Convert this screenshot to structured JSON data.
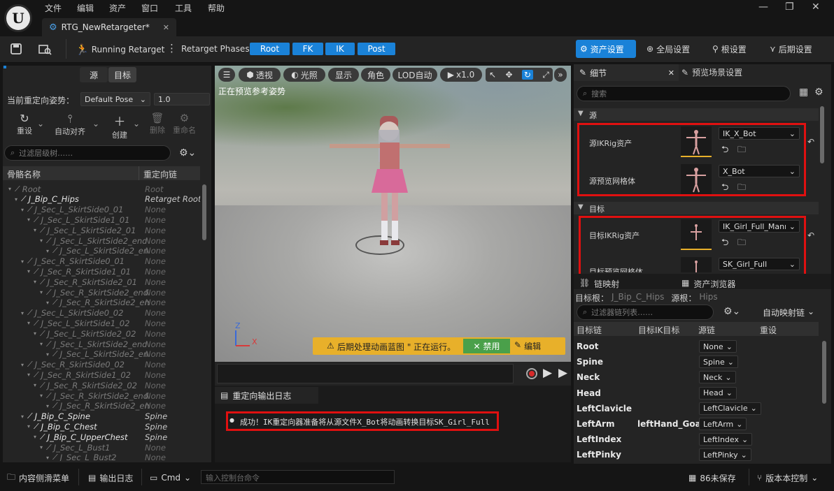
{
  "menu": [
    "文件",
    "编辑",
    "资产",
    "窗口",
    "工具",
    "帮助"
  ],
  "window_controls": {
    "minimize": "—",
    "maximize": "❐",
    "close": "✕"
  },
  "doc_tab": {
    "title": "RTG_NewRetargeter*",
    "close": "✕"
  },
  "toolbar": {
    "running_label": "Running Retarget",
    "phases_label": "Retarget Phases:",
    "phases": [
      "Root",
      "FK",
      "IK",
      "Post"
    ],
    "right_tabs": [
      "资产设置",
      "全局设置",
      "根设置",
      "后期设置"
    ]
  },
  "left_panel": {
    "seg": [
      "源",
      "目标"
    ],
    "pose_label": "当前重定向姿势：",
    "pose_value": "Default Pose",
    "pose_number": "1.0",
    "tools": [
      "重设",
      "自动对齐",
      "创建",
      "删除",
      "重命名"
    ],
    "search_placeholder": "过滤层级树……",
    "col_bone": "骨骼名称",
    "col_chain": "重定向链",
    "rows": [
      {
        "name": "Root",
        "chain": "Root",
        "depth": 0,
        "bold": false
      },
      {
        "name": "J_Bip_C_Hips",
        "chain": "Retarget Root",
        "depth": 1,
        "bold": true
      },
      {
        "name": "J_Sec_L_SkirtSide0_01",
        "chain": "None",
        "depth": 2,
        "bold": false
      },
      {
        "name": "J_Sec_L_SkirtSide1_01",
        "chain": "None",
        "depth": 3,
        "bold": false
      },
      {
        "name": "J_Sec_L_SkirtSide2_01",
        "chain": "None",
        "depth": 4,
        "bold": false
      },
      {
        "name": "J_Sec_L_SkirtSide2_end",
        "chain": "None",
        "depth": 5,
        "bold": false
      },
      {
        "name": "J_Sec_L_SkirtSide2_en",
        "chain": "None",
        "depth": 6,
        "bold": false
      },
      {
        "name": "J_Sec_R_SkirtSide0_01",
        "chain": "None",
        "depth": 2,
        "bold": false
      },
      {
        "name": "J_Sec_R_SkirtSide1_01",
        "chain": "None",
        "depth": 3,
        "bold": false
      },
      {
        "name": "J_Sec_R_SkirtSide2_01",
        "chain": "None",
        "depth": 4,
        "bold": false
      },
      {
        "name": "J_Sec_R_SkirtSide2_end",
        "chain": "None",
        "depth": 5,
        "bold": false
      },
      {
        "name": "J_Sec_R_SkirtSide2_en",
        "chain": "None",
        "depth": 6,
        "bold": false
      },
      {
        "name": "J_Sec_L_SkirtSide0_02",
        "chain": "None",
        "depth": 2,
        "bold": false
      },
      {
        "name": "J_Sec_L_SkirtSide1_02",
        "chain": "None",
        "depth": 3,
        "bold": false
      },
      {
        "name": "J_Sec_L_SkirtSide2_02",
        "chain": "None",
        "depth": 4,
        "bold": false
      },
      {
        "name": "J_Sec_L_SkirtSide2_end",
        "chain": "None",
        "depth": 5,
        "bold": false
      },
      {
        "name": "J_Sec_L_SkirtSide2_en",
        "chain": "None",
        "depth": 6,
        "bold": false
      },
      {
        "name": "J_Sec_R_SkirtSide0_02",
        "chain": "None",
        "depth": 2,
        "bold": false
      },
      {
        "name": "J_Sec_R_SkirtSide1_02",
        "chain": "None",
        "depth": 3,
        "bold": false
      },
      {
        "name": "J_Sec_R_SkirtSide2_02",
        "chain": "None",
        "depth": 4,
        "bold": false
      },
      {
        "name": "J_Sec_R_SkirtSide2_end",
        "chain": "None",
        "depth": 5,
        "bold": false
      },
      {
        "name": "J_Sec_R_SkirtSide2_en",
        "chain": "None",
        "depth": 6,
        "bold": false
      },
      {
        "name": "J_Bip_C_Spine",
        "chain": "Spine",
        "depth": 2,
        "bold": true
      },
      {
        "name": "J_Bip_C_Chest",
        "chain": "Spine",
        "depth": 3,
        "bold": true
      },
      {
        "name": "J_Bip_C_UpperChest",
        "chain": "Spine",
        "depth": 4,
        "bold": true
      },
      {
        "name": "J_Sec_L_Bust1",
        "chain": "None",
        "depth": 5,
        "bold": false
      },
      {
        "name": "J_Sec_L_Bust2",
        "chain": "None",
        "depth": 6,
        "bold": false
      }
    ]
  },
  "viewport": {
    "buttons": [
      "透视",
      "光照",
      "显示",
      "角色",
      "LOD自动",
      "x1.0"
    ],
    "preview_text": "正在预览参考姿势",
    "axis_z": "Z",
    "axis_x": "X",
    "notice": "后期处理动画蓝图 \" 正在运行。",
    "disable_btn": "禁用",
    "edit_btn": "编辑"
  },
  "log": {
    "tab": "重定向输出日志",
    "message": "成功！IK重定向器准备将从源文件X_Bot将动画转换目标SK_Girl_Full"
  },
  "details": {
    "tab_details": "细节",
    "tab_preview": "预览场景设置",
    "search_placeholder": "搜索",
    "section_source": "源",
    "section_target": "目标",
    "source_ikrig_label": "源IKRig资产",
    "source_ikrig_value": "IK_X_Bot",
    "source_mesh_label": "源预览网格体",
    "source_mesh_value": "X_Bot",
    "target_ikrig_label": "目标IKRig资产",
    "target_ikrig_value": "IK_Girl_Full_Manne",
    "target_mesh_label": "目标预览网格体",
    "target_mesh_value": "SK_Girl_Full",
    "bottom_tab1": "链映射",
    "bottom_tab2": "资产浏览器"
  },
  "chains": {
    "target_root_label": "目标根：",
    "target_root_value": "J_Bip_C_Hips",
    "source_root_label": "源根：",
    "source_root_value": "Hips",
    "search_placeholder": "过滤器链列表……",
    "auto_map": "自动映射链",
    "cols": [
      "目标链",
      "目标IK目标",
      "源链",
      "重设"
    ],
    "rows": [
      {
        "target": "Root",
        "goal": "",
        "source": "None"
      },
      {
        "target": "Spine",
        "goal": "",
        "source": "Spine"
      },
      {
        "target": "Neck",
        "goal": "",
        "source": "Neck"
      },
      {
        "target": "Head",
        "goal": "",
        "source": "Head"
      },
      {
        "target": "LeftClavicle",
        "goal": "",
        "source": "LeftClavicle"
      },
      {
        "target": "LeftArm",
        "goal": "leftHand_Goal",
        "source": "LeftArm"
      },
      {
        "target": "LeftIndex",
        "goal": "",
        "source": "LeftIndex"
      },
      {
        "target": "LeftPinky",
        "goal": "",
        "source": "LeftPinky"
      }
    ]
  },
  "statusbar": {
    "content_drawer": "内容侧滑菜单",
    "output_log": "输出日志",
    "cmd": "Cmd",
    "console_placeholder": "输入控制台命令",
    "unsaved": "86未保存",
    "version_control": "版本本控制"
  }
}
